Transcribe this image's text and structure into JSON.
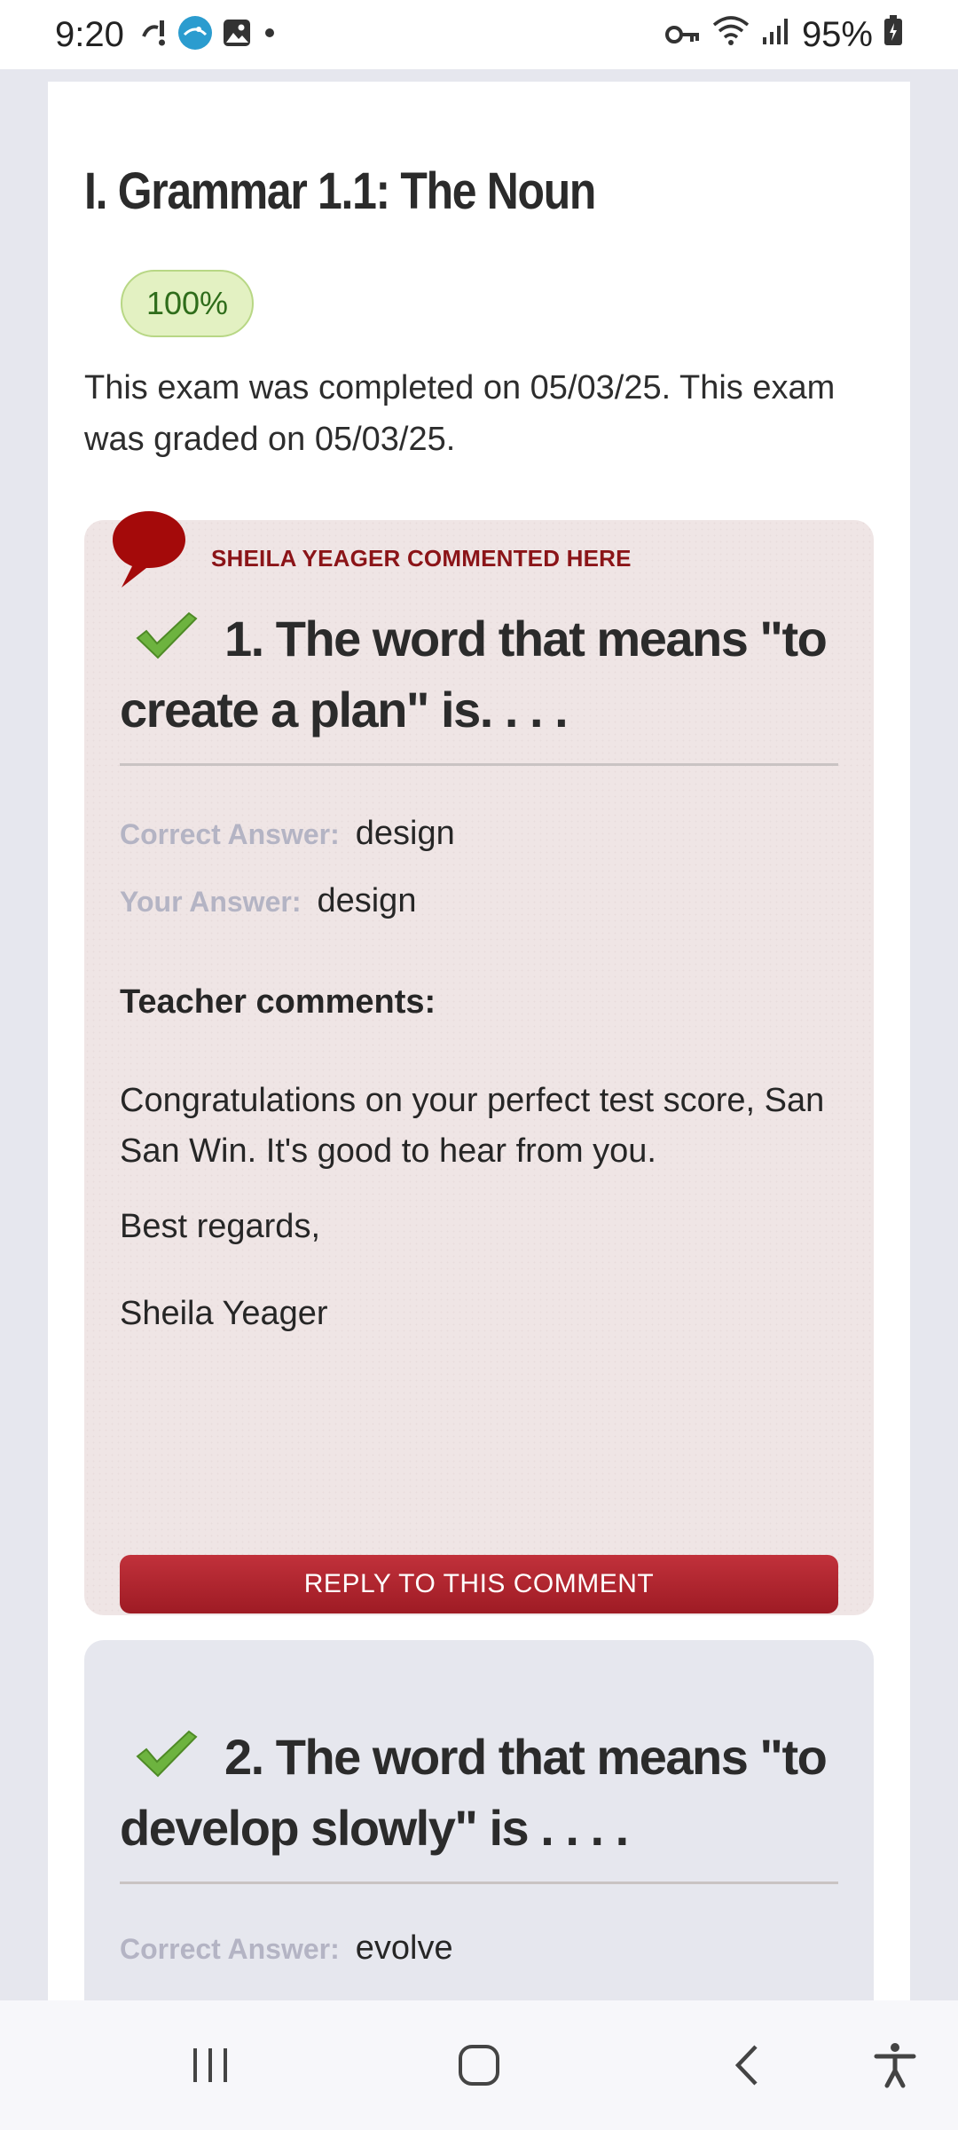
{
  "status_bar": {
    "time": "9:20",
    "battery": "95%",
    "left_icons": [
      "missed-call-icon",
      "app-icon",
      "gallery-icon",
      "dot-icon"
    ],
    "right_icons": [
      "vpn-key-icon",
      "wifi-icon",
      "signal-icon",
      "battery-icon"
    ]
  },
  "exam": {
    "title": "I. Grammar 1.1: The Noun",
    "score": "100%",
    "completion_text": "This exam was completed on 05/03/25. This exam was graded on 05/03/25."
  },
  "questions": [
    {
      "comment_author": "SHEILA YEAGER COMMENTED HERE",
      "question": "1. The word that means \"to create a plan\" is. . . .",
      "correct_label": "Correct Answer:",
      "correct_answer": "design",
      "your_label": "Your Answer:",
      "your_answer": "design",
      "teacher_heading": "Teacher comments:",
      "comment_paragraphs": [
        "Congratulations on your perfect test score, San San Win.  It's good to hear from you.",
        "Best regards,",
        "Sheila Yeager"
      ],
      "reply_label": "REPLY TO THIS COMMENT"
    },
    {
      "question": "2. The word that means \"to develop slowly\" is . . . .",
      "correct_label": "Correct Answer:",
      "correct_answer": "evolve"
    }
  ],
  "colors": {
    "accent_red": "#9e1b24",
    "score_green": "#2f6d1b",
    "comment_card_bg": "#efe5e5",
    "page_bg": "#e6e7ee"
  },
  "nav_bar": {
    "icons": [
      "recent-apps-icon",
      "home-icon",
      "back-icon",
      "accessibility-icon"
    ]
  }
}
